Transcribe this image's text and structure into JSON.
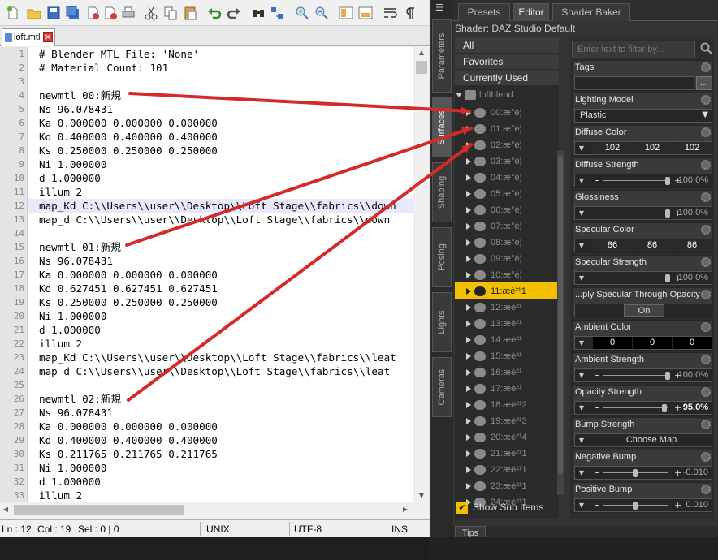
{
  "editor": {
    "tab_name": "loft.mtl",
    "tab_close": "✕",
    "current_line_index": 11,
    "lines": [
      {
        "n": "1",
        "t": "# Blender MTL File: 'None'"
      },
      {
        "n": "2",
        "t": "# Material Count: 101"
      },
      {
        "n": "3",
        "t": ""
      },
      {
        "n": "4",
        "t": "newmtl 00:新規"
      },
      {
        "n": "5",
        "t": "Ns 96.078431"
      },
      {
        "n": "6",
        "t": "Ka 0.000000 0.000000 0.000000"
      },
      {
        "n": "7",
        "t": "Kd 0.400000 0.400000 0.400000"
      },
      {
        "n": "8",
        "t": "Ks 0.250000 0.250000 0.250000"
      },
      {
        "n": "9",
        "t": "Ni 1.000000"
      },
      {
        "n": "10",
        "t": "d 1.000000"
      },
      {
        "n": "11",
        "t": "illum 2"
      },
      {
        "n": "12",
        "t": "map_Kd C:\\\\Users\\\\user\\\\Desktop\\\\Loft Stage\\\\fabrics\\\\down"
      },
      {
        "n": "13",
        "t": "map_d C:\\\\Users\\\\user\\\\Desktop\\\\Loft Stage\\\\fabrics\\\\down"
      },
      {
        "n": "14",
        "t": ""
      },
      {
        "n": "15",
        "t": "newmtl 01:新規"
      },
      {
        "n": "16",
        "t": "Ns 96.078431"
      },
      {
        "n": "17",
        "t": "Ka 0.000000 0.000000 0.000000"
      },
      {
        "n": "18",
        "t": "Kd 0.627451 0.627451 0.627451"
      },
      {
        "n": "19",
        "t": "Ks 0.250000 0.250000 0.250000"
      },
      {
        "n": "20",
        "t": "Ni 1.000000"
      },
      {
        "n": "21",
        "t": "d 1.000000"
      },
      {
        "n": "22",
        "t": "illum 2"
      },
      {
        "n": "23",
        "t": "map_Kd C:\\\\Users\\\\user\\\\Desktop\\\\Loft Stage\\\\fabrics\\\\leat"
      },
      {
        "n": "24",
        "t": "map_d C:\\\\Users\\\\user\\\\Desktop\\\\Loft Stage\\\\fabrics\\\\leat"
      },
      {
        "n": "25",
        "t": ""
      },
      {
        "n": "26",
        "t": "newmtl 02:新規"
      },
      {
        "n": "27",
        "t": "Ns 96.078431"
      },
      {
        "n": "28",
        "t": "Ka 0.000000 0.000000 0.000000"
      },
      {
        "n": "29",
        "t": "Kd 0.400000 0.400000 0.400000"
      },
      {
        "n": "30",
        "t": "Ks 0.211765 0.211765 0.211765"
      },
      {
        "n": "31",
        "t": "Ni 1.000000"
      },
      {
        "n": "32",
        "t": "d 1.000000"
      },
      {
        "n": "33",
        "t": "illum 2"
      }
    ],
    "status": {
      "line": "Ln : 12",
      "col": "Col : 19",
      "sel": "Sel : 0 | 0",
      "eol": "UNIX",
      "encoding": "UTF-8",
      "mode": "INS"
    }
  },
  "daz": {
    "tabs": [
      "Presets",
      "Editor",
      "Shader Baker"
    ],
    "active_tab": "Editor",
    "side_tabs": [
      "Parameters",
      "Surfaces",
      "Shaping",
      "Posing",
      "Lights",
      "Cameras"
    ],
    "shader_title": "Shader: DAZ Studio Default",
    "categories": [
      "All",
      "Favorites",
      "Currently Used"
    ],
    "root_name": "loftblend",
    "surfaces": [
      "00:æ°è¦",
      "01:æ°è¦",
      "02:æ°è¦",
      "03:æ°è¦",
      "04:æ°è¦",
      "05:æ°è¦",
      "06:æ°è¦",
      "07:æ°è¦",
      "08:æ°è¦",
      "09:æ°è¦",
      "10:æ°è¦",
      "11:æè²¹1",
      "12:æè²¹",
      "13:æè²¹",
      "14:æè²¹",
      "15:æè²¹",
      "16:æè²¹",
      "17:æè²¹",
      "18:æè²¹2",
      "19:æè²¹3",
      "20:æè²¹4",
      "21:æè²¹1",
      "22:æè²¹1",
      "23:æè²¹1",
      "24:æè²¹1"
    ],
    "selected_surface": "11:æè²¹1",
    "show_sub_items": "Show Sub Items",
    "show_sub_check": "✔",
    "filter_placeholder": "Enter text to filter by...",
    "tags_label": "Tags",
    "tags_button": "...",
    "properties": [
      {
        "label": "Lighting Model",
        "kind": "select",
        "value": "Plastic"
      },
      {
        "label": "Diffuse Color",
        "kind": "rgb",
        "r": "102",
        "g": "102",
        "b": "102",
        "bg": "#2a2a2a"
      },
      {
        "label": "Diffuse Strength",
        "kind": "slider",
        "value": "100.0%",
        "level": 1.0
      },
      {
        "label": "Glossiness",
        "kind": "slider",
        "value": "100.0%",
        "level": 1.0
      },
      {
        "label": "Specular Color",
        "kind": "rgb",
        "r": "86",
        "g": "86",
        "b": "86",
        "bg": "#2a2a2a"
      },
      {
        "label": "Specular Strength",
        "kind": "slider",
        "value": "100.0%",
        "level": 1.0
      },
      {
        "label": "...ply Specular Through Opacity",
        "kind": "toggle",
        "value": "On"
      },
      {
        "label": "Ambient Color",
        "kind": "rgb",
        "r": "0",
        "g": "0",
        "b": "0",
        "bg": "#000000"
      },
      {
        "label": "Ambient Strength",
        "kind": "slider",
        "value": "100.0%",
        "level": 1.0
      },
      {
        "label": "Opacity Strength",
        "kind": "slider",
        "value": "95.0%",
        "level": 0.95
      },
      {
        "label": "Bump Strength",
        "kind": "map",
        "value": "Choose Map"
      },
      {
        "label": "Negative Bump",
        "kind": "slider",
        "value": "-0.010",
        "level": 0.5
      },
      {
        "label": "Positive Bump",
        "kind": "slider",
        "value": "0.010",
        "level": 0.5
      }
    ],
    "tips_label": "Tips"
  },
  "annotations": {
    "color": "#d42a2a"
  }
}
